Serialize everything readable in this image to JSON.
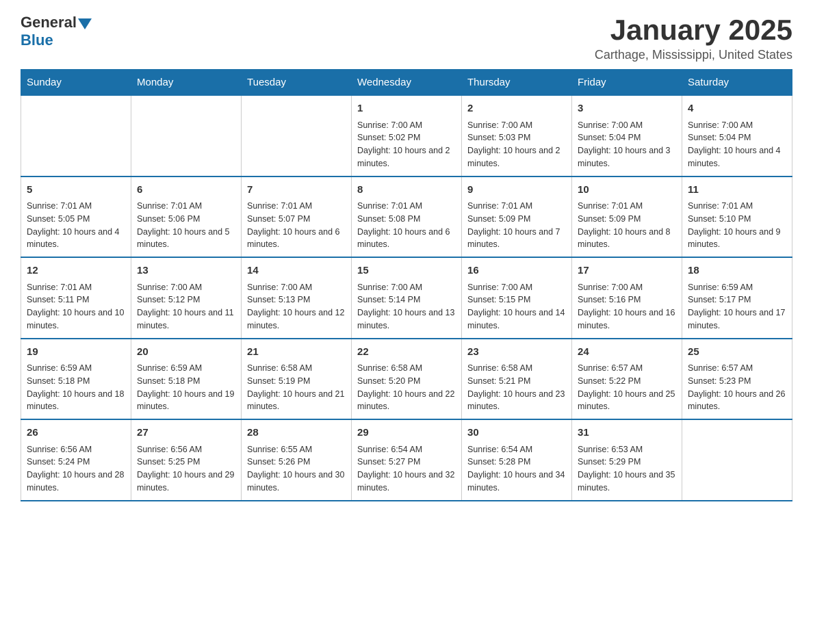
{
  "header": {
    "logo_general": "General",
    "logo_blue": "Blue",
    "title": "January 2025",
    "subtitle": "Carthage, Mississippi, United States"
  },
  "days_of_week": [
    "Sunday",
    "Monday",
    "Tuesday",
    "Wednesday",
    "Thursday",
    "Friday",
    "Saturday"
  ],
  "weeks": [
    [
      {
        "day": "",
        "info": ""
      },
      {
        "day": "",
        "info": ""
      },
      {
        "day": "",
        "info": ""
      },
      {
        "day": "1",
        "info": "Sunrise: 7:00 AM\nSunset: 5:02 PM\nDaylight: 10 hours and 2 minutes."
      },
      {
        "day": "2",
        "info": "Sunrise: 7:00 AM\nSunset: 5:03 PM\nDaylight: 10 hours and 2 minutes."
      },
      {
        "day": "3",
        "info": "Sunrise: 7:00 AM\nSunset: 5:04 PM\nDaylight: 10 hours and 3 minutes."
      },
      {
        "day": "4",
        "info": "Sunrise: 7:00 AM\nSunset: 5:04 PM\nDaylight: 10 hours and 4 minutes."
      }
    ],
    [
      {
        "day": "5",
        "info": "Sunrise: 7:01 AM\nSunset: 5:05 PM\nDaylight: 10 hours and 4 minutes."
      },
      {
        "day": "6",
        "info": "Sunrise: 7:01 AM\nSunset: 5:06 PM\nDaylight: 10 hours and 5 minutes."
      },
      {
        "day": "7",
        "info": "Sunrise: 7:01 AM\nSunset: 5:07 PM\nDaylight: 10 hours and 6 minutes."
      },
      {
        "day": "8",
        "info": "Sunrise: 7:01 AM\nSunset: 5:08 PM\nDaylight: 10 hours and 6 minutes."
      },
      {
        "day": "9",
        "info": "Sunrise: 7:01 AM\nSunset: 5:09 PM\nDaylight: 10 hours and 7 minutes."
      },
      {
        "day": "10",
        "info": "Sunrise: 7:01 AM\nSunset: 5:09 PM\nDaylight: 10 hours and 8 minutes."
      },
      {
        "day": "11",
        "info": "Sunrise: 7:01 AM\nSunset: 5:10 PM\nDaylight: 10 hours and 9 minutes."
      }
    ],
    [
      {
        "day": "12",
        "info": "Sunrise: 7:01 AM\nSunset: 5:11 PM\nDaylight: 10 hours and 10 minutes."
      },
      {
        "day": "13",
        "info": "Sunrise: 7:00 AM\nSunset: 5:12 PM\nDaylight: 10 hours and 11 minutes."
      },
      {
        "day": "14",
        "info": "Sunrise: 7:00 AM\nSunset: 5:13 PM\nDaylight: 10 hours and 12 minutes."
      },
      {
        "day": "15",
        "info": "Sunrise: 7:00 AM\nSunset: 5:14 PM\nDaylight: 10 hours and 13 minutes."
      },
      {
        "day": "16",
        "info": "Sunrise: 7:00 AM\nSunset: 5:15 PM\nDaylight: 10 hours and 14 minutes."
      },
      {
        "day": "17",
        "info": "Sunrise: 7:00 AM\nSunset: 5:16 PM\nDaylight: 10 hours and 16 minutes."
      },
      {
        "day": "18",
        "info": "Sunrise: 6:59 AM\nSunset: 5:17 PM\nDaylight: 10 hours and 17 minutes."
      }
    ],
    [
      {
        "day": "19",
        "info": "Sunrise: 6:59 AM\nSunset: 5:18 PM\nDaylight: 10 hours and 18 minutes."
      },
      {
        "day": "20",
        "info": "Sunrise: 6:59 AM\nSunset: 5:18 PM\nDaylight: 10 hours and 19 minutes."
      },
      {
        "day": "21",
        "info": "Sunrise: 6:58 AM\nSunset: 5:19 PM\nDaylight: 10 hours and 21 minutes."
      },
      {
        "day": "22",
        "info": "Sunrise: 6:58 AM\nSunset: 5:20 PM\nDaylight: 10 hours and 22 minutes."
      },
      {
        "day": "23",
        "info": "Sunrise: 6:58 AM\nSunset: 5:21 PM\nDaylight: 10 hours and 23 minutes."
      },
      {
        "day": "24",
        "info": "Sunrise: 6:57 AM\nSunset: 5:22 PM\nDaylight: 10 hours and 25 minutes."
      },
      {
        "day": "25",
        "info": "Sunrise: 6:57 AM\nSunset: 5:23 PM\nDaylight: 10 hours and 26 minutes."
      }
    ],
    [
      {
        "day": "26",
        "info": "Sunrise: 6:56 AM\nSunset: 5:24 PM\nDaylight: 10 hours and 28 minutes."
      },
      {
        "day": "27",
        "info": "Sunrise: 6:56 AM\nSunset: 5:25 PM\nDaylight: 10 hours and 29 minutes."
      },
      {
        "day": "28",
        "info": "Sunrise: 6:55 AM\nSunset: 5:26 PM\nDaylight: 10 hours and 30 minutes."
      },
      {
        "day": "29",
        "info": "Sunrise: 6:54 AM\nSunset: 5:27 PM\nDaylight: 10 hours and 32 minutes."
      },
      {
        "day": "30",
        "info": "Sunrise: 6:54 AM\nSunset: 5:28 PM\nDaylight: 10 hours and 34 minutes."
      },
      {
        "day": "31",
        "info": "Sunrise: 6:53 AM\nSunset: 5:29 PM\nDaylight: 10 hours and 35 minutes."
      },
      {
        "day": "",
        "info": ""
      }
    ]
  ]
}
